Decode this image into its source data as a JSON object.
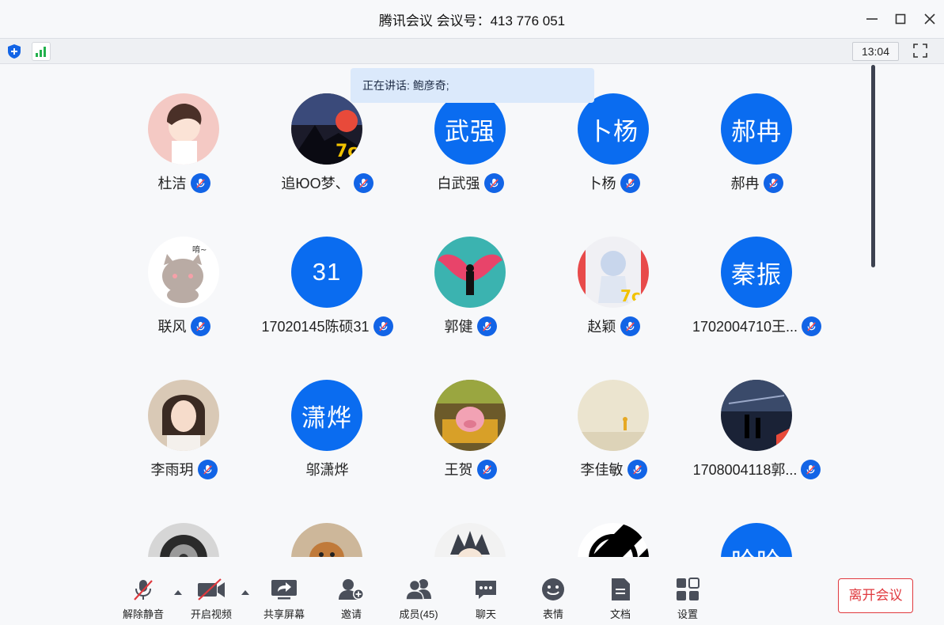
{
  "window": {
    "title": "腾讯会议 会议号：413 776 051"
  },
  "statusbar": {
    "time": "13:04"
  },
  "speaking": {
    "text": "正在讲话: 鲍彦奇;"
  },
  "participants": [
    {
      "name": "杜洁",
      "avatar_type": "photo",
      "avatar_desc": "anime-boy-portrait"
    },
    {
      "name": "追ЮO梦、",
      "avatar_type": "photo",
      "avatar_desc": "silhouette-sunset"
    },
    {
      "name": "白武强",
      "avatar_type": "text",
      "initials": "武强"
    },
    {
      "name": "卜杨",
      "avatar_type": "text",
      "initials": "卜杨"
    },
    {
      "name": "郝冉",
      "avatar_type": "text",
      "initials": "郝冉"
    },
    {
      "name": "联风",
      "avatar_type": "photo",
      "avatar_desc": "cartoon-cat"
    },
    {
      "name": "17020145陈硕31",
      "avatar_type": "text",
      "initials": "31"
    },
    {
      "name": "郭健",
      "avatar_type": "photo",
      "avatar_desc": "angel-wings-wall"
    },
    {
      "name": "赵颖",
      "avatar_type": "photo",
      "avatar_desc": "anime-character"
    },
    {
      "name": "1702004710王...",
      "avatar_type": "text",
      "initials": "秦振"
    },
    {
      "name": "李雨玥",
      "avatar_type": "photo",
      "avatar_desc": "girl-portrait"
    },
    {
      "name": "邬潇烨",
      "avatar_type": "text",
      "initials": "潇烨"
    },
    {
      "name": "王贺",
      "avatar_type": "photo",
      "avatar_desc": "cartoon-pig"
    },
    {
      "name": "李佳敏",
      "avatar_type": "photo",
      "avatar_desc": "small-figure-landscape"
    },
    {
      "name": "1708004118郭...",
      "avatar_type": "photo",
      "avatar_desc": "rainy-night"
    },
    {
      "name": "",
      "avatar_type": "photo",
      "avatar_desc": "car-wheel"
    },
    {
      "name": "",
      "avatar_type": "photo",
      "avatar_desc": "puppy"
    },
    {
      "name": "",
      "avatar_type": "photo",
      "avatar_desc": "anime-wolf-boy"
    },
    {
      "name": "",
      "avatar_type": "photo",
      "avatar_desc": "black-white-abstract"
    },
    {
      "name": "",
      "avatar_type": "text",
      "initials": "哈哈"
    }
  ],
  "toolbar": {
    "unmute": "解除静音",
    "start_video": "开启视频",
    "share_screen": "共享屏幕",
    "invite": "邀请",
    "members": "成员(45)",
    "chat": "聊天",
    "reactions": "表情",
    "documents": "文档",
    "settings": "设置",
    "leave": "离开会议"
  },
  "colors": {
    "accent": "#0a6cf0",
    "leave": "#e0393e",
    "signal": "#22b14c"
  }
}
